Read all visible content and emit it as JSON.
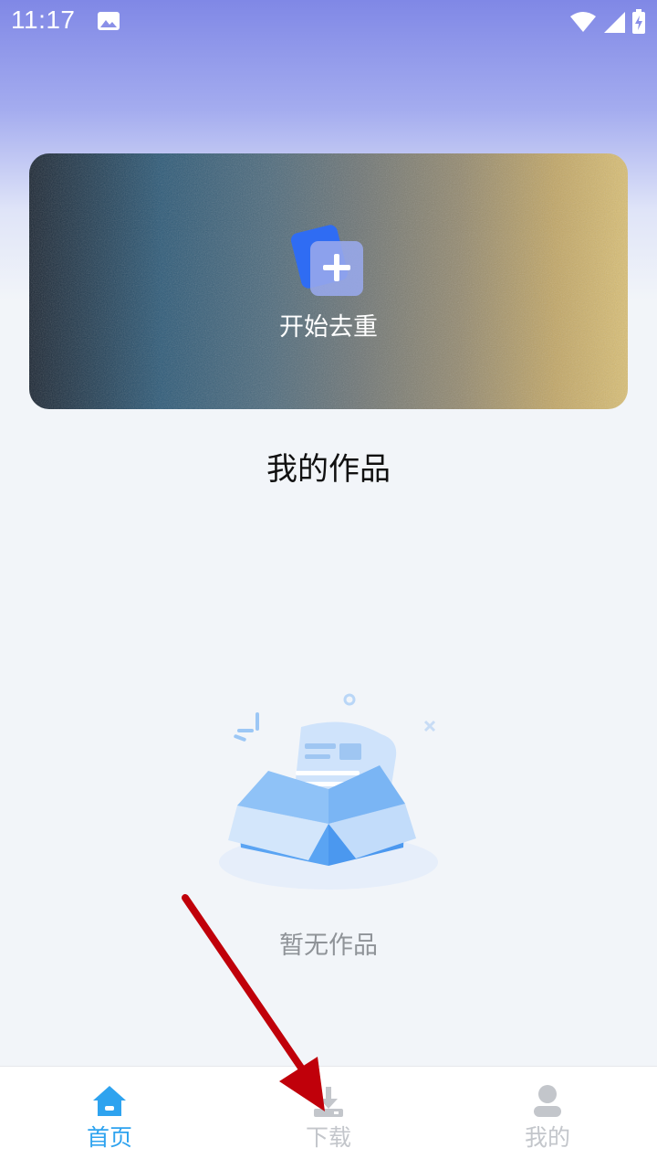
{
  "status_bar": {
    "time": "11:17",
    "icons": [
      "gallery-icon",
      "wifi-icon",
      "signal-icon",
      "battery-charging-icon"
    ]
  },
  "banner": {
    "label": "开始去重",
    "icon": "add-document-icon",
    "colors": {
      "left": "#1c2734",
      "right": "#d9bf76",
      "icon": "#3b6ff5"
    }
  },
  "section": {
    "title": "我的作品"
  },
  "empty_state": {
    "text": "暂无作品",
    "illustration": "empty-box-illustration"
  },
  "tab_bar": {
    "items": [
      {
        "label": "首页",
        "icon": "home-icon",
        "active": true
      },
      {
        "label": "下载",
        "icon": "download-icon",
        "active": false
      },
      {
        "label": "我的",
        "icon": "user-icon",
        "active": false
      }
    ],
    "active_color": "#2ea3ef",
    "inactive_color": "#c3c6cb"
  },
  "annotation": {
    "type": "red-arrow",
    "color": "#c0000a",
    "points_to": "下载"
  }
}
